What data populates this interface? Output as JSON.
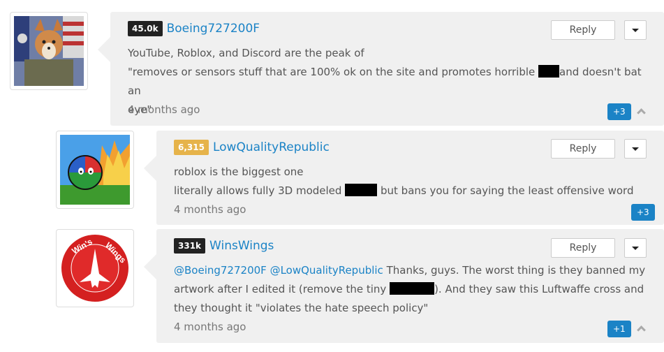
{
  "comments": [
    {
      "reputation": "45.0k",
      "username": "Boeing727200F",
      "line1": "YouTube, Roblox, and Discord are the peak of",
      "line2a": "\"removes or sensors stuff that are 100% ok on the site and promotes horrible",
      "line2b": "and doesn't bat an",
      "line3": "eye\"",
      "time": "4 months ago",
      "votes": "+3",
      "reply_label": "Reply"
    },
    {
      "reputation": "6,315",
      "username": "LowQualityRepublic",
      "line1": "roblox is the biggest one",
      "line2a": "literally allows fully 3D modeled",
      "line2b": "but bans you for saying the least offensive word",
      "time": "4 months ago",
      "votes": "+3",
      "reply_label": "Reply"
    },
    {
      "reputation": "331k",
      "username": "WinsWings",
      "mention1": "@Boeing727200F",
      "mention2": "@LowQualityRepublic",
      "line1": "Thanks, guys. The worst thing is they banned my",
      "line2a": "artwork after I edited it (remove the tiny",
      "line2b": "). And they saw this Luftwaffe cross and",
      "line3": "they thought it  \"violates the hate speech policy\"",
      "time": "4 months ago",
      "votes": "+1",
      "reply_label": "Reply",
      "avatar_text_top": "Win's",
      "avatar_text_right": "Wings"
    }
  ],
  "colors": {
    "accent": "#1b83c6",
    "bubble": "#f0f0f0",
    "rep_dark": "#222222",
    "rep_gold": "#e6b34a"
  }
}
